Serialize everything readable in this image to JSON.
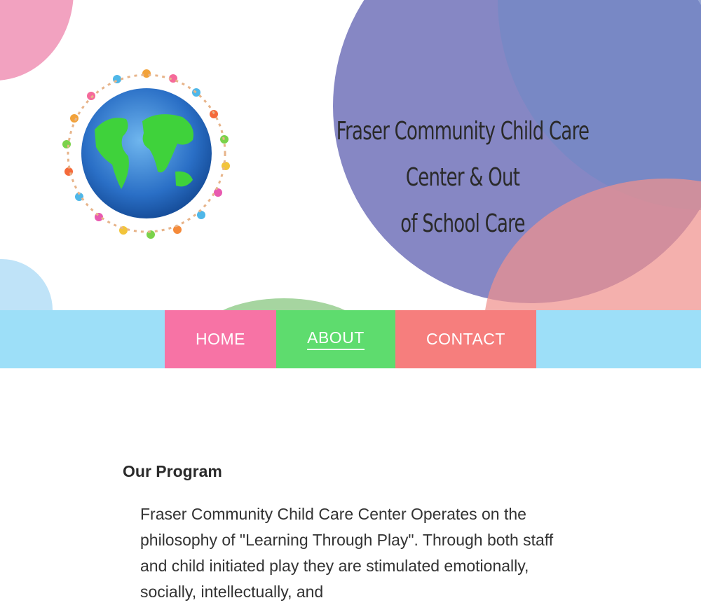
{
  "header": {
    "site_title_line1": "Fraser Community Child Care Center & Out",
    "site_title_line2": "of School Care",
    "logo_icon": "globe-children-icon"
  },
  "nav": {
    "items": [
      {
        "label": "HOME"
      },
      {
        "label": "ABOUT",
        "active": true
      },
      {
        "label": "CONTACT"
      }
    ]
  },
  "main": {
    "section_title": "Our Program",
    "section_body": "Fraser Community Child Care Center Operates on the philosophy of \"Learning Through Play\". Through both staff and child initiated play they are stimulated emotionally, socially, intellectually, and"
  },
  "colors": {
    "nav_bg": "#9ddff8",
    "home": "#f773a5",
    "about": "#5edc6e",
    "contact": "#f67e7d",
    "purple_blob": "#8687c4"
  }
}
